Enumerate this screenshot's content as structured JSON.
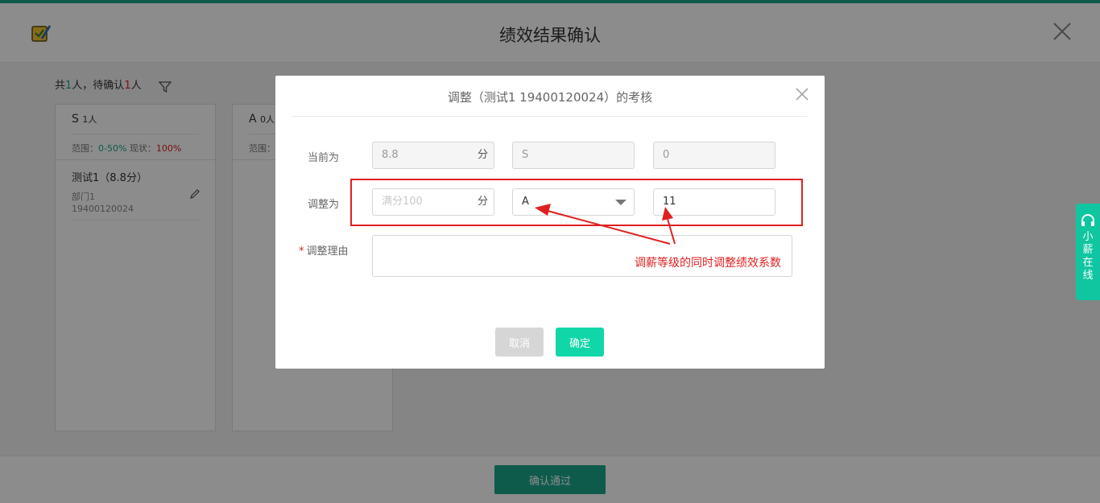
{
  "header": {
    "title": "绩效结果确认"
  },
  "summary": {
    "prefix": "共",
    "total": "1",
    "mid": "人，待确认",
    "pending": "1",
    "suffix": "人"
  },
  "cards": [
    {
      "grade": "S",
      "count": "1人",
      "range_label": "范围：",
      "range": "0-50%",
      "status_label": " 现状：",
      "status": "100%",
      "person": {
        "name": "测试1（8.8分）",
        "dept": "部门1",
        "id": "19400120024"
      }
    },
    {
      "grade": "A",
      "count": "0人",
      "range_label": "范围："
    }
  ],
  "footer": {
    "confirm_label": "确认通过"
  },
  "side_widget": {
    "label": "小薪在线"
  },
  "modal": {
    "title": "调整（测试1 19400120024）的考核",
    "current_label": "当前为",
    "current_score": "8.8",
    "score_unit": "分",
    "current_grade": "S",
    "current_coef": "0",
    "adjust_label": "调整为",
    "adjust_score_placeholder": "满分100",
    "adjust_grade": "A",
    "adjust_coef": "11",
    "reason_star": "*",
    "reason_label": "调整理由",
    "cancel_label": "取消",
    "ok_label": "确定"
  },
  "annotation": {
    "text": "调薪等级的同时调整绩效系数"
  },
  "colors": {
    "primary": "#1aa68a",
    "accent": "#10d6a8",
    "danger": "#e02020"
  }
}
